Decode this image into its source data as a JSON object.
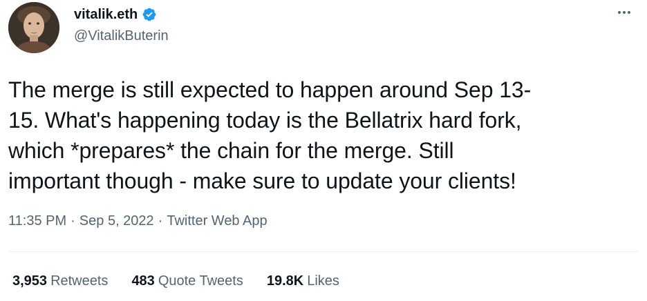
{
  "author": {
    "display_name": "vitalik.eth",
    "handle": "@VitalikButerin",
    "verified_icon": "verified-badge-icon",
    "verified_color": "#1d9bf0"
  },
  "more_icon": "more-horizontal-icon",
  "tweet": {
    "text": "The merge is still expected to happen around Sep 13-\n15. What's happening today is the Bellatrix hard fork,\nwhich *prepares* the chain for the merge. Still\nimportant though - make sure to update your clients!",
    "time": "11:35 PM",
    "date": "Sep 5, 2022",
    "source": "Twitter Web App",
    "separator": "·"
  },
  "stats": {
    "retweets": {
      "value": "3,953",
      "label": "Retweets"
    },
    "quote_tweets": {
      "value": "483",
      "label": "Quote Tweets"
    },
    "likes": {
      "value": "19.8K",
      "label": "Likes"
    }
  },
  "colors": {
    "text_primary": "#0f1419",
    "text_secondary": "#536471",
    "divider": "#eff3f4"
  }
}
